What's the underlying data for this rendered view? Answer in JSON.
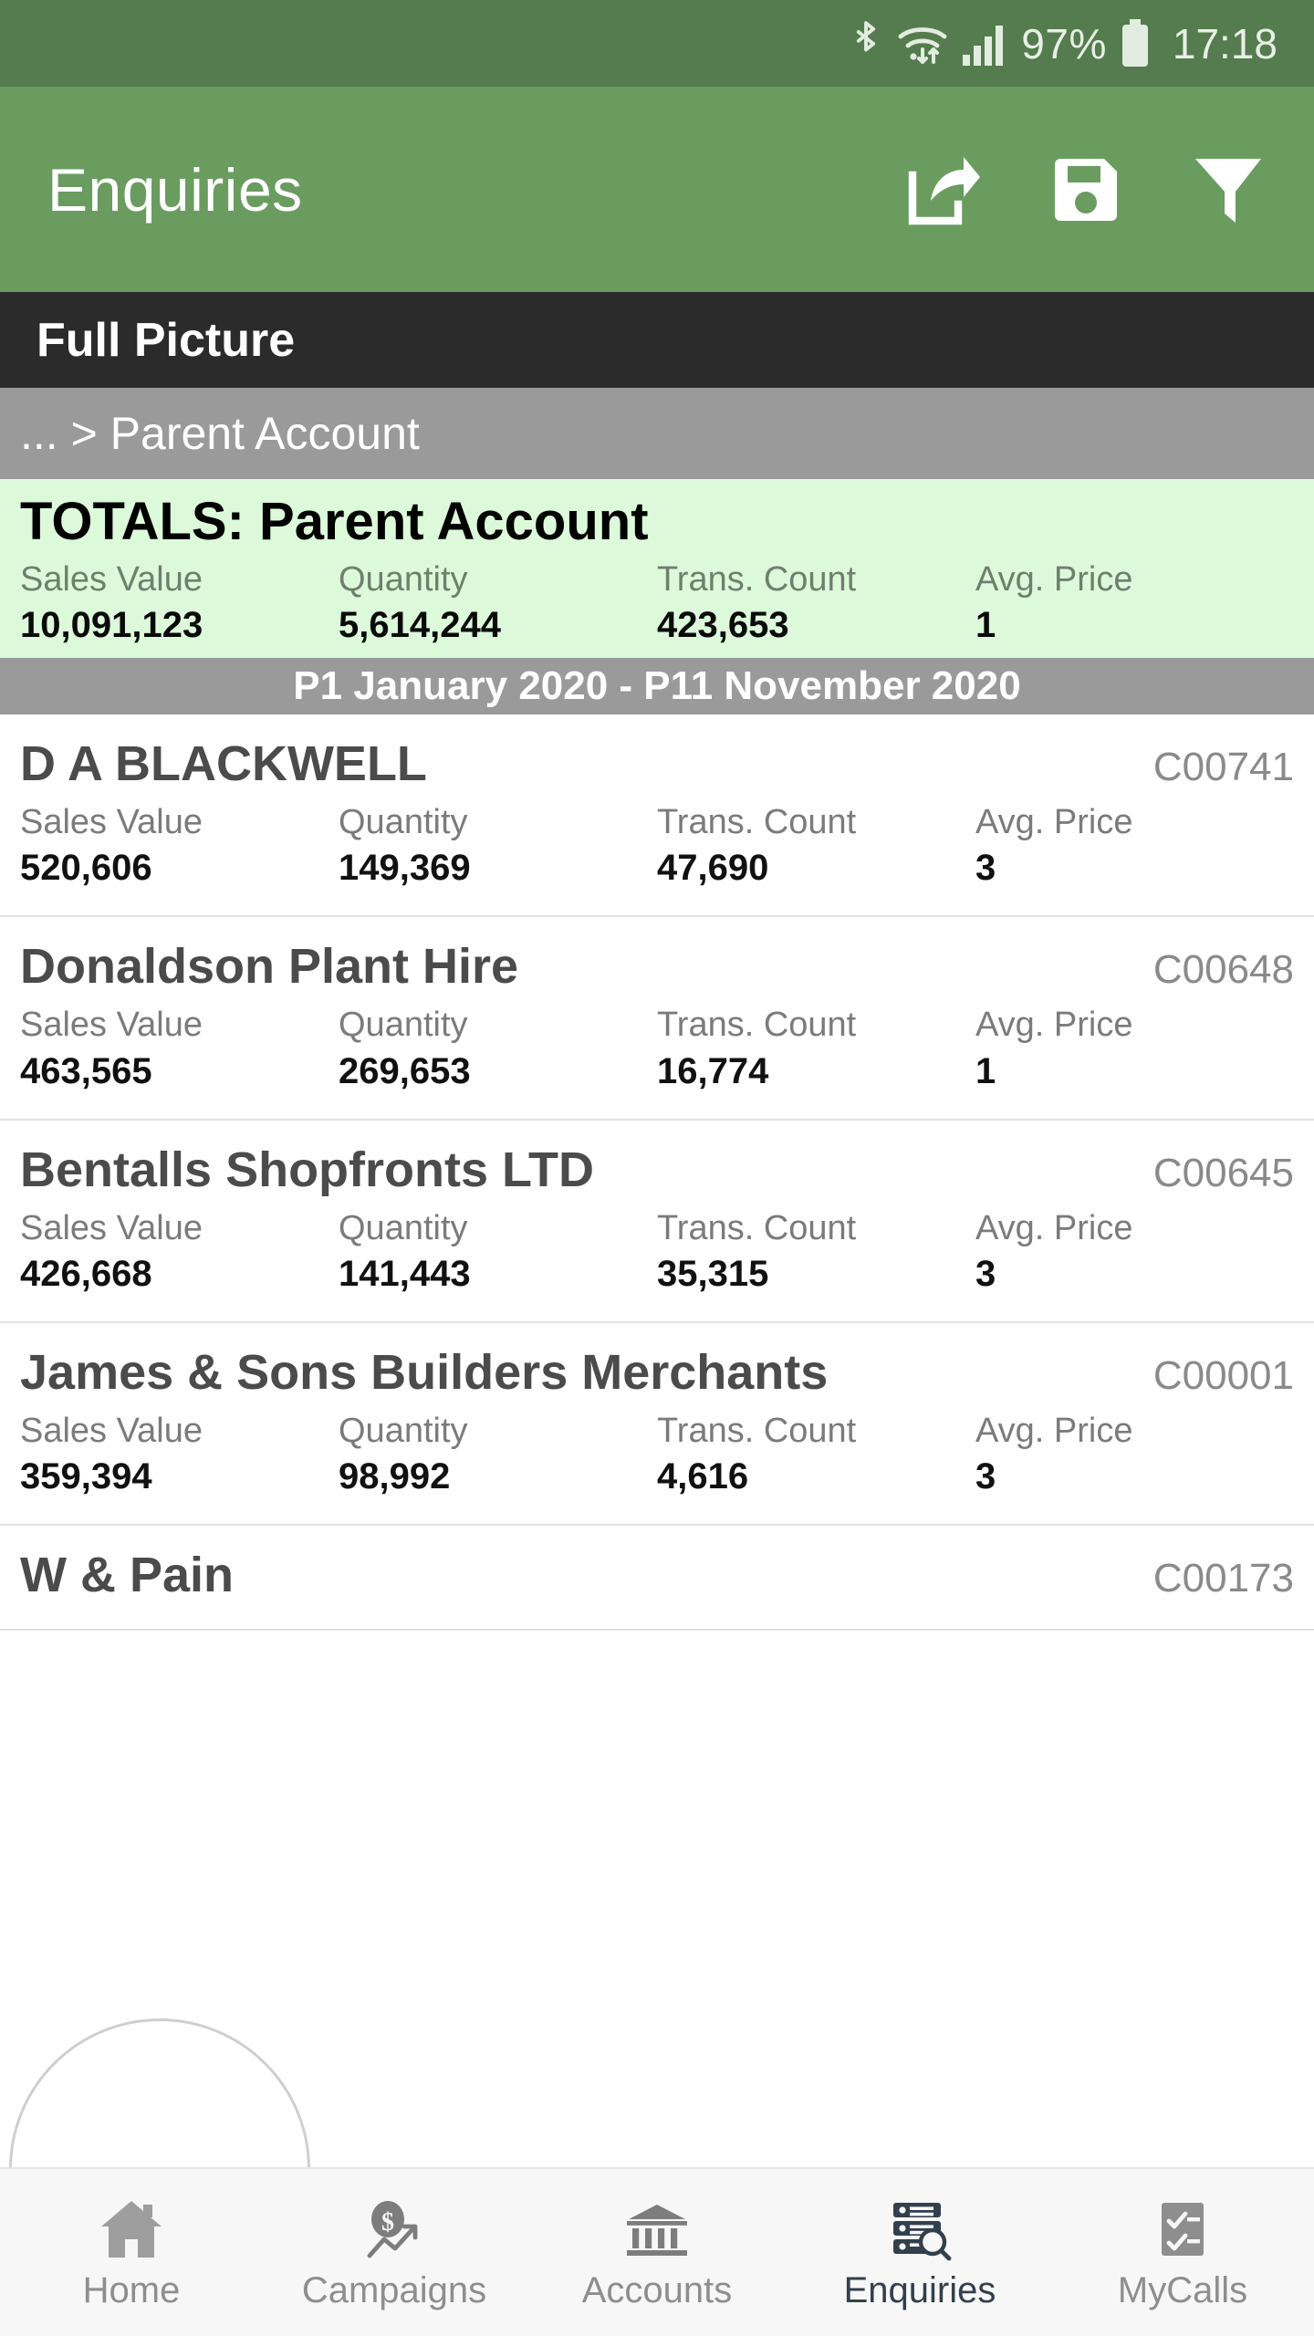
{
  "statusbar": {
    "battery_percent": "97%",
    "clock": "17:18",
    "icons": [
      "bluetooth-icon",
      "wifi-icon",
      "signal-icon",
      "battery-icon"
    ]
  },
  "appbar": {
    "title": "Enquiries",
    "actions": [
      {
        "name": "export-button",
        "icon": "export-icon"
      },
      {
        "name": "save-button",
        "icon": "save-icon"
      },
      {
        "name": "filter-button",
        "icon": "filter-icon"
      }
    ]
  },
  "section": {
    "title": "Full Picture"
  },
  "breadcrumb": {
    "text": "... > Parent Account"
  },
  "totals": {
    "title": "TOTALS: Parent Account",
    "metrics": [
      {
        "label": "Sales Value",
        "value": "10,091,123"
      },
      {
        "label": "Quantity",
        "value": "5,614,244"
      },
      {
        "label": "Trans. Count",
        "value": "423,653"
      },
      {
        "label": "Avg. Price",
        "value": "1"
      }
    ]
  },
  "period": {
    "text": "P1 January 2020 - P11 November 2020"
  },
  "rows": [
    {
      "name": "D A BLACKWELL",
      "code": "C00741",
      "metrics": [
        {
          "label": "Sales Value",
          "value": "520,606"
        },
        {
          "label": "Quantity",
          "value": "149,369"
        },
        {
          "label": "Trans. Count",
          "value": "47,690"
        },
        {
          "label": "Avg. Price",
          "value": "3"
        }
      ]
    },
    {
      "name": "Donaldson Plant Hire",
      "code": "C00648",
      "metrics": [
        {
          "label": "Sales Value",
          "value": "463,565"
        },
        {
          "label": "Quantity",
          "value": "269,653"
        },
        {
          "label": "Trans. Count",
          "value": "16,774"
        },
        {
          "label": "Avg. Price",
          "value": "1"
        }
      ]
    },
    {
      "name": "Bentalls Shopfronts LTD",
      "code": "C00645",
      "metrics": [
        {
          "label": "Sales Value",
          "value": "426,668"
        },
        {
          "label": "Quantity",
          "value": "141,443"
        },
        {
          "label": "Trans. Count",
          "value": "35,315"
        },
        {
          "label": "Avg. Price",
          "value": "3"
        }
      ]
    },
    {
      "name": "James & Sons Builders Merchants",
      "code": "C00001",
      "metrics": [
        {
          "label": "Sales Value",
          "value": "359,394"
        },
        {
          "label": "Quantity",
          "value": "98,992"
        },
        {
          "label": "Trans. Count",
          "value": "4,616"
        },
        {
          "label": "Avg. Price",
          "value": "3"
        }
      ]
    },
    {
      "name": "W & Pain",
      "code": "C00173",
      "metrics": []
    }
  ],
  "bottomnav": {
    "items": [
      {
        "label": "Home",
        "icon": "home-icon",
        "active": false
      },
      {
        "label": "Campaigns",
        "icon": "campaigns-icon",
        "active": false
      },
      {
        "label": "Accounts",
        "icon": "accounts-icon",
        "active": false
      },
      {
        "label": "Enquiries",
        "icon": "enquiries-icon",
        "active": true
      },
      {
        "label": "MyCalls",
        "icon": "mycalls-icon",
        "active": false
      }
    ]
  },
  "colors": {
    "statusbar": "#547c4e",
    "appbar": "#6a9c60",
    "section_dark": "#2b2b2b",
    "breadcrumb": "#9a9a9a",
    "totals_bg": "#dcfada",
    "period_bg": "#9a9a9a",
    "nav_active": "#333f4d",
    "nav_inactive": "#8e8e8e"
  }
}
